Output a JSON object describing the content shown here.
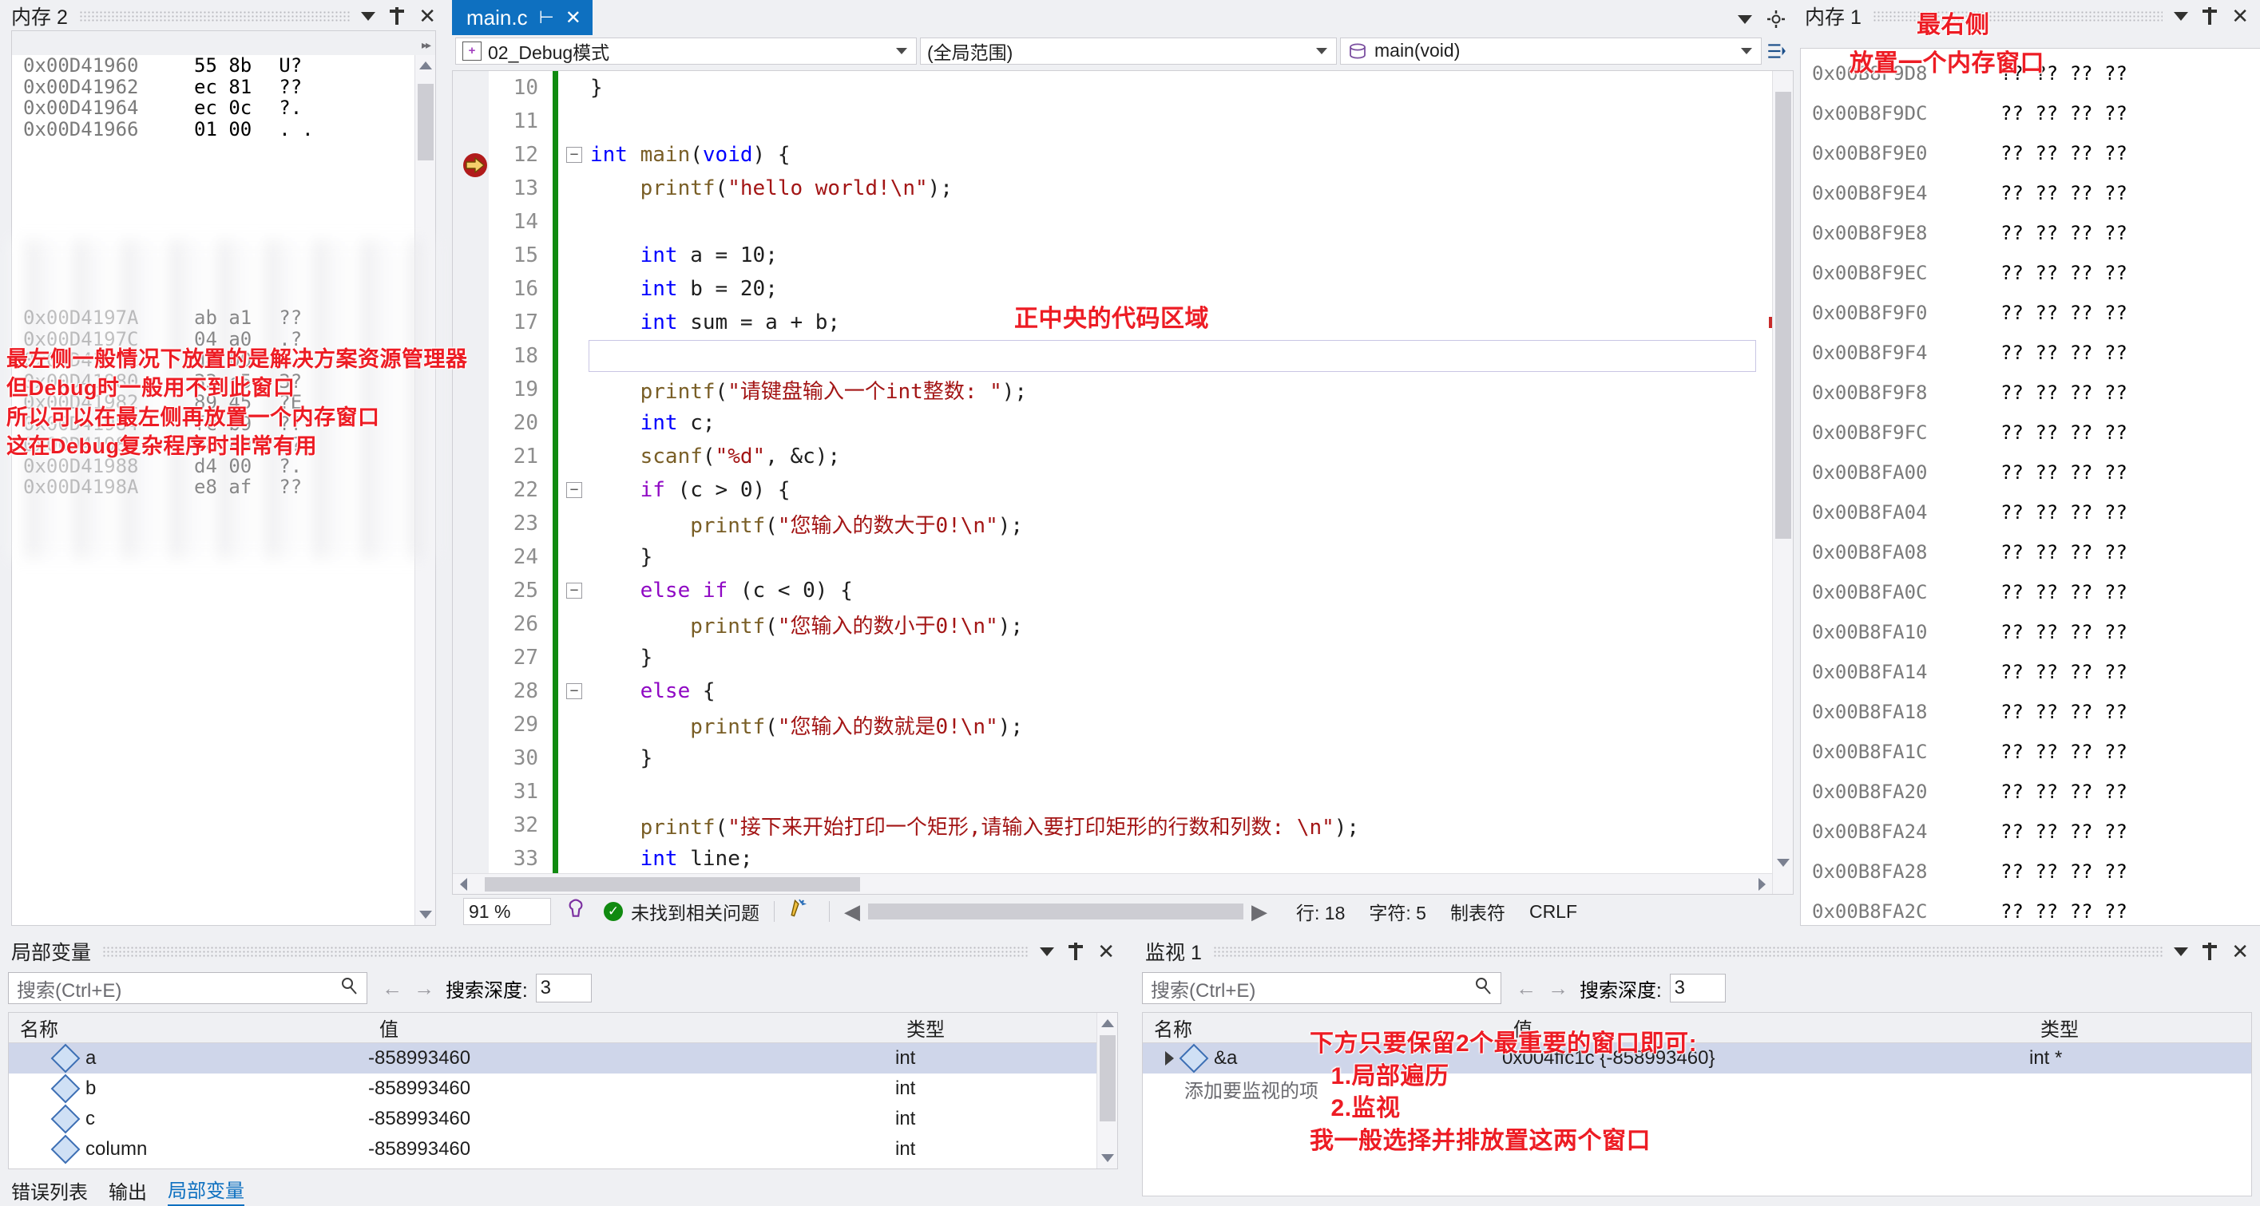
{
  "memory_left": {
    "title": "内存 2",
    "rows": [
      {
        "addr": "0x00D41960",
        "bytes": "55 8b",
        "ascii": "U?"
      },
      {
        "addr": "0x00D41962",
        "bytes": "ec 81",
        "ascii": "??"
      },
      {
        "addr": "0x00D41964",
        "bytes": "ec 0c",
        "ascii": "?."
      },
      {
        "addr": "0x00D41966",
        "bytes": "01 00",
        "ascii": ". ."
      },
      {
        "addr": "0x00D4197A",
        "bytes": "ab a1",
        "ascii": "??"
      },
      {
        "addr": "0x00D4197C",
        "bytes": "04 a0",
        "ascii": ".?"
      },
      {
        "addr": "0x00D4197E",
        "bytes": "d4 00",
        "ascii": "?."
      },
      {
        "addr": "0x00D41980",
        "bytes": "33 c5",
        "ascii": "3?"
      },
      {
        "addr": "0x00D41982",
        "bytes": "89 45",
        "ascii": "?E"
      },
      {
        "addr": "0x00D41984",
        "bytes": "fc b9",
        "ascii": "??"
      },
      {
        "addr": "0x00D41986",
        "bytes": "08 c0",
        "ascii": ".?"
      },
      {
        "addr": "0x00D41988",
        "bytes": "d4 00",
        "ascii": "?."
      },
      {
        "addr": "0x00D4198A",
        "bytes": "e8 af",
        "ascii": "??"
      }
    ]
  },
  "memory_right": {
    "title": "内存 1",
    "rows": [
      {
        "addr": "0x00B8F9D8",
        "bytes": "?? ?? ?? ??"
      },
      {
        "addr": "0x00B8F9DC",
        "bytes": "?? ?? ?? ??"
      },
      {
        "addr": "0x00B8F9E0",
        "bytes": "?? ?? ?? ??"
      },
      {
        "addr": "0x00B8F9E4",
        "bytes": "?? ?? ?? ??"
      },
      {
        "addr": "0x00B8F9E8",
        "bytes": "?? ?? ?? ??"
      },
      {
        "addr": "0x00B8F9EC",
        "bytes": "?? ?? ?? ??"
      },
      {
        "addr": "0x00B8F9F0",
        "bytes": "?? ?? ?? ??"
      },
      {
        "addr": "0x00B8F9F4",
        "bytes": "?? ?? ?? ??"
      },
      {
        "addr": "0x00B8F9F8",
        "bytes": "?? ?? ?? ??"
      },
      {
        "addr": "0x00B8F9FC",
        "bytes": "?? ?? ?? ??"
      },
      {
        "addr": "0x00B8FA00",
        "bytes": "?? ?? ?? ??"
      },
      {
        "addr": "0x00B8FA04",
        "bytes": "?? ?? ?? ??"
      },
      {
        "addr": "0x00B8FA08",
        "bytes": "?? ?? ?? ??"
      },
      {
        "addr": "0x00B8FA0C",
        "bytes": "?? ?? ?? ??"
      },
      {
        "addr": "0x00B8FA10",
        "bytes": "?? ?? ?? ??"
      },
      {
        "addr": "0x00B8FA14",
        "bytes": "?? ?? ?? ??"
      },
      {
        "addr": "0x00B8FA18",
        "bytes": "?? ?? ?? ??"
      },
      {
        "addr": "0x00B8FA1C",
        "bytes": "?? ?? ?? ??"
      },
      {
        "addr": "0x00B8FA20",
        "bytes": "?? ?? ?? ??"
      },
      {
        "addr": "0x00B8FA24",
        "bytes": "?? ?? ?? ??"
      },
      {
        "addr": "0x00B8FA28",
        "bytes": "?? ?? ?? ??"
      },
      {
        "addr": "0x00B8FA2C",
        "bytes": "?? ?? ?? ??"
      }
    ]
  },
  "editor": {
    "tab_name": "main.c",
    "project_combo": "02_Debug模式",
    "scope_combo": "(全局范围)",
    "member_combo": "main(void)",
    "lines": [
      {
        "n": "10",
        "fold": "",
        "tokens": [
          {
            "t": "}",
            "c": "pun"
          }
        ],
        "indent": 0
      },
      {
        "n": "11",
        "fold": "",
        "tokens": [],
        "indent": 0
      },
      {
        "n": "12",
        "fold": "-",
        "tokens": [
          {
            "t": "int ",
            "c": "kw"
          },
          {
            "t": "main",
            "c": "fn"
          },
          {
            "t": "(",
            "c": "pun"
          },
          {
            "t": "void",
            "c": "kw"
          },
          {
            "t": ") {",
            "c": "pun"
          }
        ],
        "indent": 0
      },
      {
        "n": "13",
        "fold": "",
        "tokens": [
          {
            "t": "printf",
            "c": "fn"
          },
          {
            "t": "(",
            "c": "pun"
          },
          {
            "t": "\"hello world!\\n\"",
            "c": "str"
          },
          {
            "t": ");",
            "c": "pun"
          }
        ],
        "indent": 1
      },
      {
        "n": "14",
        "fold": "",
        "tokens": [],
        "indent": 1
      },
      {
        "n": "15",
        "fold": "",
        "tokens": [
          {
            "t": "int",
            "c": "kw"
          },
          {
            "t": " a = ",
            "c": "pun"
          },
          {
            "t": "10",
            "c": "pun"
          },
          {
            "t": ";",
            "c": "pun"
          }
        ],
        "indent": 1
      },
      {
        "n": "16",
        "fold": "",
        "tokens": [
          {
            "t": "int",
            "c": "kw"
          },
          {
            "t": " b = ",
            "c": "pun"
          },
          {
            "t": "20",
            "c": "pun"
          },
          {
            "t": ";",
            "c": "pun"
          }
        ],
        "indent": 1
      },
      {
        "n": "17",
        "fold": "",
        "tokens": [
          {
            "t": "int",
            "c": "kw"
          },
          {
            "t": " sum = a + b;",
            "c": "pun"
          }
        ],
        "indent": 1
      },
      {
        "n": "18",
        "fold": "",
        "tokens": [],
        "indent": 1
      },
      {
        "n": "19",
        "fold": "",
        "tokens": [
          {
            "t": "printf",
            "c": "fn"
          },
          {
            "t": "(",
            "c": "pun"
          },
          {
            "t": "\"请键盘输入一个int整数: \"",
            "c": "str"
          },
          {
            "t": ");",
            "c": "pun"
          }
        ],
        "indent": 1
      },
      {
        "n": "20",
        "fold": "",
        "tokens": [
          {
            "t": "int",
            "c": "kw"
          },
          {
            "t": " c;",
            "c": "pun"
          }
        ],
        "indent": 1
      },
      {
        "n": "21",
        "fold": "",
        "tokens": [
          {
            "t": "scanf",
            "c": "fn"
          },
          {
            "t": "(",
            "c": "pun"
          },
          {
            "t": "\"%d\"",
            "c": "str"
          },
          {
            "t": ", &c);",
            "c": "pun"
          }
        ],
        "indent": 1
      },
      {
        "n": "22",
        "fold": "-",
        "tokens": [
          {
            "t": "if",
            "c": "ctl"
          },
          {
            "t": " (c > ",
            "c": "pun"
          },
          {
            "t": "0",
            "c": "pun"
          },
          {
            "t": ") {",
            "c": "pun"
          }
        ],
        "indent": 1
      },
      {
        "n": "23",
        "fold": "",
        "tokens": [
          {
            "t": "printf",
            "c": "fn"
          },
          {
            "t": "(",
            "c": "pun"
          },
          {
            "t": "\"您输入的数大于0!\\n\"",
            "c": "str"
          },
          {
            "t": ");",
            "c": "pun"
          }
        ],
        "indent": 2
      },
      {
        "n": "24",
        "fold": "",
        "tokens": [
          {
            "t": "}",
            "c": "pun"
          }
        ],
        "indent": 1
      },
      {
        "n": "25",
        "fold": "-",
        "tokens": [
          {
            "t": "else",
            "c": "ctl"
          },
          {
            "t": " ",
            "c": "pun"
          },
          {
            "t": "if",
            "c": "ctl"
          },
          {
            "t": " (c < ",
            "c": "pun"
          },
          {
            "t": "0",
            "c": "pun"
          },
          {
            "t": ") {",
            "c": "pun"
          }
        ],
        "indent": 1
      },
      {
        "n": "26",
        "fold": "",
        "tokens": [
          {
            "t": "printf",
            "c": "fn"
          },
          {
            "t": "(",
            "c": "pun"
          },
          {
            "t": "\"您输入的数小于0!\\n\"",
            "c": "str"
          },
          {
            "t": ");",
            "c": "pun"
          }
        ],
        "indent": 2
      },
      {
        "n": "27",
        "fold": "",
        "tokens": [
          {
            "t": "}",
            "c": "pun"
          }
        ],
        "indent": 1
      },
      {
        "n": "28",
        "fold": "-",
        "tokens": [
          {
            "t": "else",
            "c": "ctl"
          },
          {
            "t": " {",
            "c": "pun"
          }
        ],
        "indent": 1
      },
      {
        "n": "29",
        "fold": "",
        "tokens": [
          {
            "t": "printf",
            "c": "fn"
          },
          {
            "t": "(",
            "c": "pun"
          },
          {
            "t": "\"您输入的数就是0!\\n\"",
            "c": "str"
          },
          {
            "t": ");",
            "c": "pun"
          }
        ],
        "indent": 2
      },
      {
        "n": "30",
        "fold": "",
        "tokens": [
          {
            "t": "}",
            "c": "pun"
          }
        ],
        "indent": 1
      },
      {
        "n": "31",
        "fold": "",
        "tokens": [],
        "indent": 1
      },
      {
        "n": "32",
        "fold": "",
        "tokens": [
          {
            "t": "printf",
            "c": "fn"
          },
          {
            "t": "(",
            "c": "pun"
          },
          {
            "t": "\"接下来开始打印一个矩形,请输入要打印矩形的行数和列数: \\n\"",
            "c": "str"
          },
          {
            "t": ");",
            "c": "pun"
          }
        ],
        "indent": 1
      },
      {
        "n": "33",
        "fold": "",
        "tokens": [
          {
            "t": "int",
            "c": "kw"
          },
          {
            "t": " line;",
            "c": "pun"
          }
        ],
        "indent": 1
      }
    ],
    "status": {
      "zoom": "91 %",
      "problems": "未找到相关问题",
      "line": "行: 18",
      "col": "字符: 5",
      "tabs": "制表符",
      "eol": "CRLF"
    }
  },
  "locals": {
    "title": "局部变量",
    "search_placeholder": "搜索(Ctrl+E)",
    "depth_label": "搜索深度:",
    "depth_value": "3",
    "columns": [
      "名称",
      "值",
      "类型"
    ],
    "rows": [
      {
        "name": "a",
        "value": "-858993460",
        "type": "int"
      },
      {
        "name": "b",
        "value": "-858993460",
        "type": "int"
      },
      {
        "name": "c",
        "value": "-858993460",
        "type": "int"
      },
      {
        "name": "column",
        "value": "-858993460",
        "type": "int"
      }
    ],
    "bottom_tabs": [
      "错误列表",
      "输出",
      "局部变量"
    ],
    "active_bottom_tab": "局部变量"
  },
  "watch": {
    "title": "监视 1",
    "search_placeholder": "搜索(Ctrl+E)",
    "depth_label": "搜索深度:",
    "depth_value": "3",
    "columns": [
      "名称",
      "值",
      "类型"
    ],
    "rows": [
      {
        "name": "&a",
        "value": "0x004ffc1c {-858993460}",
        "type": "int *"
      }
    ],
    "add_row_hint": "添加要监视的项"
  },
  "annotations": {
    "left": "最左侧一般情况下放置的是解决方案资源管理器\n但Debug时一般用不到此窗口\n所以可以在最左侧再放置一个内存窗口\n这在Debug复杂程序时非常有用",
    "center": "正中央的代码区域",
    "right_line1": "最右侧",
    "right_line2": "放置一个内存窗口",
    "bottom": "下方只要保留2个最重要的窗口即可:\n   1.局部遍历\n   2.监视\n我一般选择并排放置这两个窗口"
  },
  "colors": {
    "accent": "#0e70c0",
    "annotation": "#ed1c24",
    "changebar": "#108a10",
    "chrome": "#eff0f3"
  }
}
